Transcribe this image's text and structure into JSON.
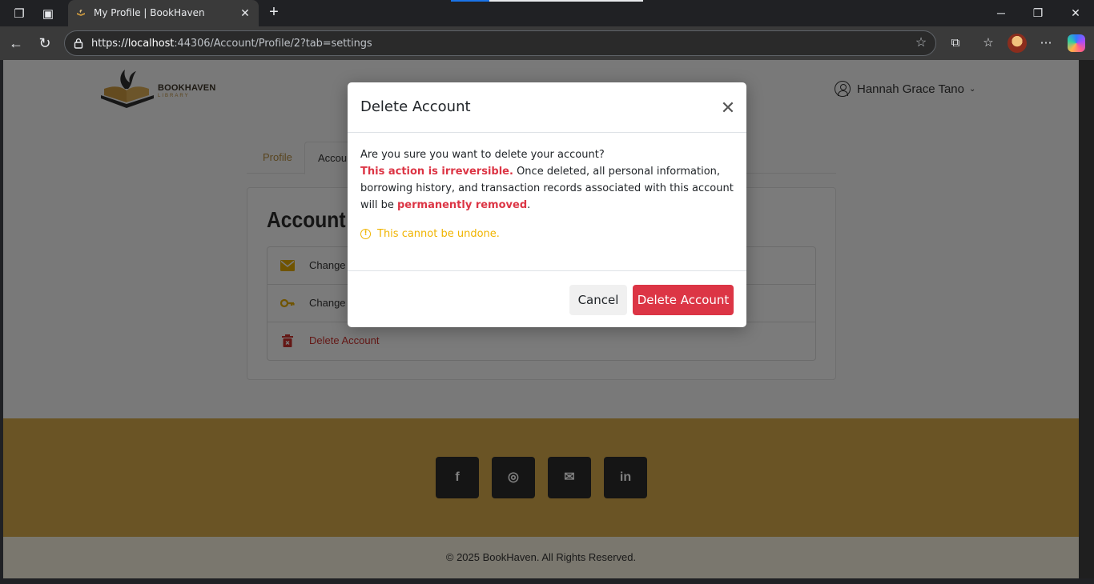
{
  "browser": {
    "tab_title": "My Profile | BookHaven",
    "url_prefix": "https://",
    "url_host": "localhost",
    "url_path": ":44306/Account/Profile/2?tab=settings"
  },
  "header": {
    "logo_text": "BOOKHAVEN",
    "logo_sub": "LIBRARY",
    "user_name": "Hannah Grace Tano"
  },
  "tabs": [
    {
      "label": "Profile"
    },
    {
      "label": "Accou"
    }
  ],
  "card": {
    "title": "Account S",
    "items": [
      {
        "label": "Change",
        "icon": "envelope-icon"
      },
      {
        "label": "Change",
        "icon": "key-icon"
      },
      {
        "label": "Delete Account",
        "icon": "trash-icon"
      }
    ]
  },
  "footer": {
    "social": [
      "f",
      "◎",
      "✉",
      "in"
    ],
    "copyright": "© 2025 BookHaven. All Rights Reserved."
  },
  "modal": {
    "title": "Delete Account",
    "question": "Are you sure you want to delete your account?",
    "irreversible": "This action is irreversible.",
    "body_mid": " Once deleted, all personal information, borrowing history, and transaction records associated with this account will be ",
    "removed": "permanently removed",
    "period": ".",
    "warning": "This cannot be undone.",
    "cancel_label": "Cancel",
    "delete_label": "Delete Account"
  },
  "colors": {
    "danger": "#dc3545",
    "warning": "#f0b400",
    "brand_gold": "#d4a94a"
  }
}
